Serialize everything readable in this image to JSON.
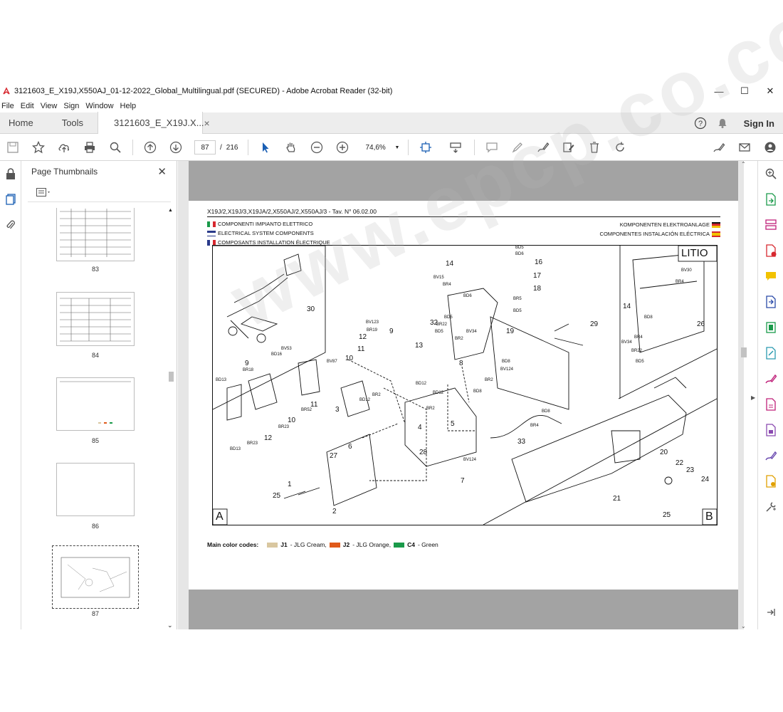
{
  "window": {
    "title": "3121603_E_X19J,X550AJ_01-12-2022_Global_Multilingual.pdf (SECURED) - Adobe Acrobat Reader (32-bit)",
    "controls": {
      "minimize": "—",
      "maximize": "☐",
      "close": "✕"
    }
  },
  "menu": {
    "items": [
      "File",
      "Edit",
      "View",
      "Sign",
      "Window",
      "Help"
    ]
  },
  "tabs": {
    "home": "Home",
    "tools": "Tools",
    "doc": "3121603_E_X19J.X...",
    "doc_close": "×",
    "sign_in": "Sign In"
  },
  "toolbar": {
    "page_current": "87",
    "page_sep": "/",
    "page_total": "216",
    "zoom": "74,6%"
  },
  "thumbnails": {
    "title": "Page Thumbnails",
    "pages": [
      "83",
      "84",
      "85",
      "86",
      "87"
    ],
    "selected": "87"
  },
  "page": {
    "title": "X19J/2,X19J/3,X19JA/2,X550AJ/2,X550AJ/3 - Tav. N° 06.02.00",
    "lang_it": "COMPONENTI IMPIANTO ELETTRICO",
    "lang_en": "ELECTRICAL SYSTEM COMPONENTS",
    "lang_fr": "COMPOSANTS INSTALLATION ÉLECTRIQUE",
    "lang_de": "KOMPONENTEN ELEKTROANLAGE",
    "lang_es": "COMPONENTES INSTALACIÓN ELÉCTRICA",
    "corner_a": "A",
    "corner_b": "B",
    "box_label": "LITIO",
    "legend_title": "Main color codes:",
    "legend_items": [
      {
        "code": "J1",
        "text": " - JLG Cream,",
        "color": "#d9c7a0"
      },
      {
        "code": "J2",
        "text": " - JLG Orange,",
        "color": "#e05a1a"
      },
      {
        "code": "C4",
        "text": " - Green",
        "color": "#1a9a4a"
      }
    ],
    "callouts_large": [
      "1",
      "2",
      "3",
      "4",
      "5",
      "6",
      "7",
      "8",
      "9",
      "9",
      "10",
      "10",
      "11",
      "11",
      "12",
      "12",
      "13",
      "14",
      "14",
      "16",
      "17",
      "18",
      "19",
      "20",
      "21",
      "22",
      "23",
      "24",
      "25",
      "25",
      "26",
      "27",
      "28",
      "29",
      "30",
      "32",
      "33"
    ],
    "callouts_small": [
      "BD5",
      "BD6",
      "BV15",
      "BR4",
      "BD6",
      "BR5",
      "BD5",
      "BV123",
      "BR19",
      "BV34",
      "BR2",
      "BD5",
      "BR22",
      "BD5",
      "BV53",
      "BD16",
      "BR18",
      "BD13",
      "BR52",
      "BR23",
      "BV87",
      "BD12",
      "BR2",
      "BD12",
      "BD12",
      "BR2",
      "BV124",
      "BD8",
      "BR2",
      "BD8",
      "BD8",
      "BR4",
      "BV124",
      "BV30",
      "BR4",
      "BV34",
      "BR4",
      "BD8",
      "BR22",
      "BD5",
      "BR23",
      "BD13"
    ]
  },
  "watermark": "www.epcp.co.com"
}
